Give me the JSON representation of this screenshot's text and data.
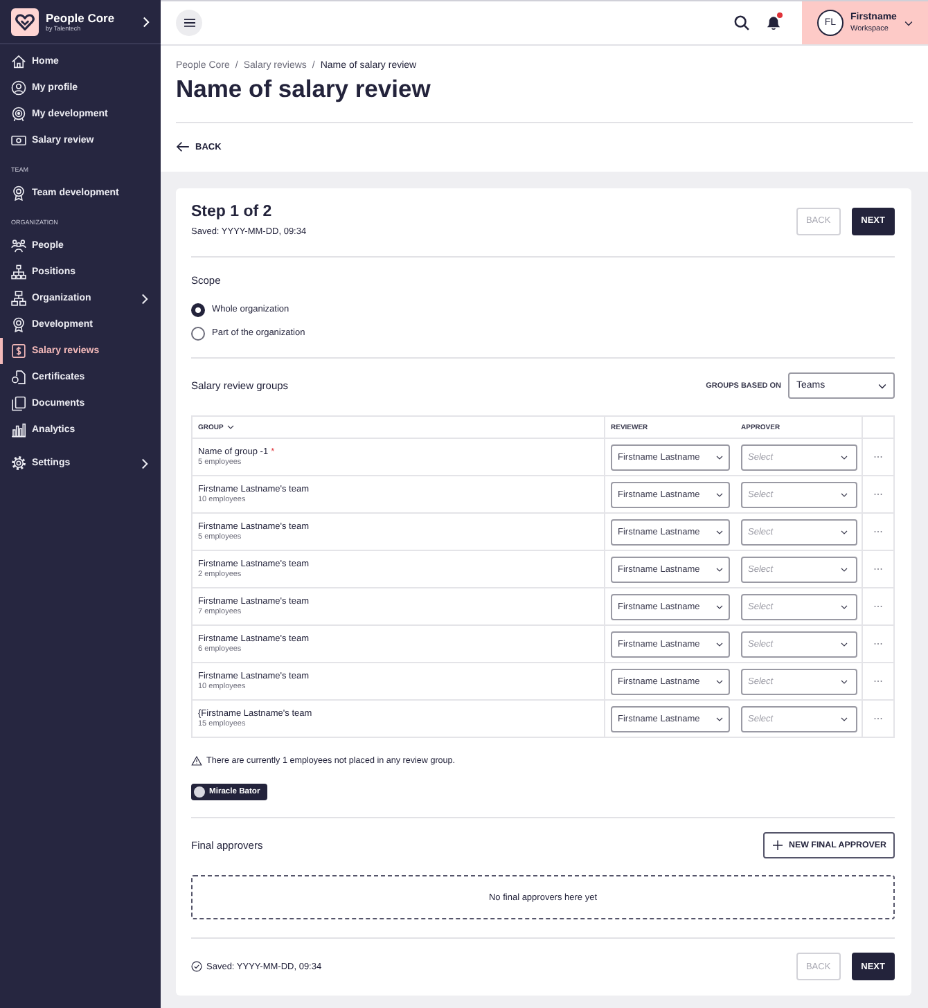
{
  "sidebar": {
    "brand": {
      "name": "People Core",
      "tagline": "by Talentech"
    },
    "sections": [
      {
        "items": [
          {
            "label": "Home",
            "selected": false,
            "has_submenu": false
          },
          {
            "label": "My profile",
            "selected": false,
            "has_submenu": false
          },
          {
            "label": "My development",
            "selected": false,
            "has_submenu": false
          },
          {
            "label": "Salary review",
            "selected": false,
            "has_submenu": false
          }
        ]
      },
      {
        "heading": "TEAM",
        "items": [
          {
            "label": "Team development",
            "selected": false,
            "has_submenu": false
          }
        ]
      },
      {
        "heading": "ORGANIZATION",
        "items": [
          {
            "label": "People",
            "selected": false,
            "has_submenu": false
          },
          {
            "label": "Positions",
            "selected": false,
            "has_submenu": false
          },
          {
            "label": "Organization",
            "selected": false,
            "has_submenu": true
          },
          {
            "label": "Development",
            "selected": false,
            "has_submenu": false
          },
          {
            "label": "Salary reviews",
            "selected": true,
            "has_submenu": false
          },
          {
            "label": "Certificates",
            "selected": false,
            "has_submenu": false
          },
          {
            "label": "Documents",
            "selected": false,
            "has_submenu": false
          },
          {
            "label": "Analytics",
            "selected": false,
            "has_submenu": false
          }
        ]
      },
      {
        "items": [
          {
            "label": "Settings",
            "selected": false,
            "has_submenu": true
          }
        ]
      }
    ]
  },
  "header": {
    "notifications": {
      "unread": true
    },
    "user": {
      "initials": "FL",
      "name": "Firstname",
      "workspace": "Workspace"
    }
  },
  "page": {
    "breadcrumb": {
      "separator": "/",
      "items": [
        {
          "label": "People Core",
          "current": false
        },
        {
          "label": "Salary reviews",
          "current": false
        },
        {
          "label": "Name of salary review",
          "current": true
        }
      ]
    },
    "title": "Name of salary review",
    "back_link": "BACK"
  },
  "wizard": {
    "step": "Step 1 of 2",
    "saved": "Saved: YYYY-MM-DD, 09:34",
    "back_button": {
      "label": "BACK",
      "disabled": true
    },
    "next_button": {
      "label": "NEXT",
      "disabled": false
    },
    "scope": {
      "title": "Scope",
      "options": [
        {
          "label": "Whole organization",
          "selected": true
        },
        {
          "label": "Part of the organization",
          "selected": false
        }
      ]
    },
    "groups": {
      "title": "Salary review groups",
      "based_on_label": "GROUPS BASED ON",
      "based_on": "Teams",
      "columns": [
        {
          "label": "GROUP",
          "sortable": true
        },
        {
          "label": "REVIEWER",
          "sortable": false
        },
        {
          "label": "APPROVER",
          "sortable": false
        }
      ],
      "rows": [
        {
          "name": "Name of group -1",
          "required_mark": "*",
          "count": "5 employees",
          "reviewer": "Firstname Lastname",
          "approver_placeholder": "Select"
        },
        {
          "name": "Firstname Lastname's team",
          "count": "10 employees",
          "reviewer": "Firstname Lastname",
          "approver_placeholder": "Select"
        },
        {
          "name": "Firstname Lastname's team",
          "count": "5 employees",
          "reviewer": "Firstname Lastname",
          "approver_placeholder": "Select"
        },
        {
          "name": "Firstname Lastname's team",
          "count": "2 employees",
          "reviewer": "Firstname Lastname",
          "approver_placeholder": "Select"
        },
        {
          "name": "Firstname Lastname's team",
          "count": "7 employees",
          "reviewer": "Firstname Lastname",
          "approver_placeholder": "Select"
        },
        {
          "name": "Firstname Lastname's team",
          "count": "6 employees",
          "reviewer": "Firstname Lastname",
          "approver_placeholder": "Select"
        },
        {
          "name": "Firstname Lastname's team",
          "count": "10 employees",
          "reviewer": "Firstname Lastname",
          "approver_placeholder": "Select"
        },
        {
          "name": "{Firstname Lastname's team",
          "count": "15 employees",
          "reviewer": "Firstname Lastname",
          "approver_placeholder": "Select"
        }
      ]
    },
    "unplaced": {
      "warning": "There are currently 1 employees not placed in any review group.",
      "employees": [
        {
          "name": "Miracle Bator"
        }
      ]
    },
    "final_approvers": {
      "title": "Final approvers",
      "add_button": "NEW FINAL APPROVER",
      "empty": "No final approvers here yet"
    },
    "footer": {
      "saved": "Saved: YYYY-MM-DD, 09:34",
      "back_button": {
        "label": "BACK",
        "disabled": true
      },
      "next_button": {
        "label": "NEXT",
        "disabled": false
      }
    }
  }
}
